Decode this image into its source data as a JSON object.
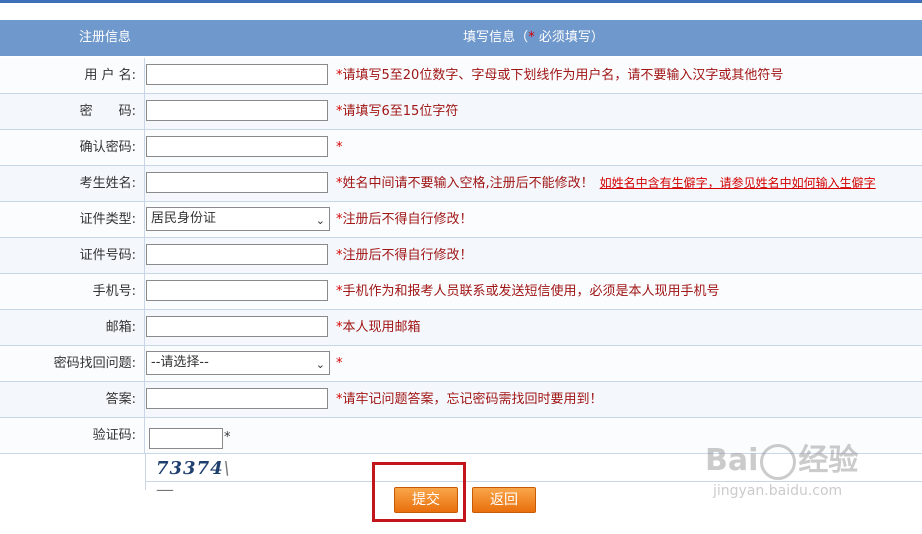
{
  "header": {
    "left": "注册信息",
    "right_prefix": "填写信息（",
    "right_star": "*",
    "right_suffix": " 必须填写）"
  },
  "form": {
    "rows": [
      {
        "label": "用 户 名:",
        "type": "text",
        "value": "",
        "hint_star": "*",
        "hint": "请填写5至20位数字、字母或下划线作为用户名，请不要输入汉字或其他符号"
      },
      {
        "label": "密　　码:",
        "type": "text",
        "value": "",
        "hint_star": "*",
        "hint": "请填写6至15位字符"
      },
      {
        "label": "确认密码:",
        "type": "text",
        "value": "",
        "hint_star": "*",
        "hint": ""
      },
      {
        "label": "考生姓名:",
        "type": "text",
        "value": "",
        "hint_star": "*",
        "hint": "姓名中间请不要输入空格,注册后不能修改！",
        "link": "如姓名中含有生僻字，请参见姓名中如何输入生僻字"
      },
      {
        "label": "证件类型:",
        "type": "select",
        "value": "居民身份证",
        "hint_star": "*",
        "hint": "注册后不得自行修改！"
      },
      {
        "label": "证件号码:",
        "type": "text",
        "value": "",
        "hint_star": "*",
        "hint": "注册后不得自行修改！"
      },
      {
        "label": "手机号:",
        "type": "text",
        "value": "",
        "hint_star": "*",
        "hint": "手机作为和报考人员联系或发送短信使用，必须是本人现用手机号"
      },
      {
        "label": "邮箱:",
        "type": "text",
        "value": "",
        "hint_star": "*",
        "hint": "本人现用邮箱"
      },
      {
        "label": "密码找回问题:",
        "type": "select",
        "value": "--请选择--",
        "hint_star": "*",
        "hint": ""
      },
      {
        "label": "答案:",
        "type": "text",
        "value": "",
        "hint_star": "*",
        "hint": "请牢记问题答案，忘记密码需找回时要用到！"
      }
    ],
    "captcha_label": "验证码:",
    "captcha_star": "*",
    "captcha_image_text": "73374",
    "captcha_image_tail": "\\—"
  },
  "buttons": {
    "submit": "提交",
    "back": "返回"
  },
  "watermark": {
    "main_left": "Bai",
    "main_right": "经验",
    "sub": "jingyan.baidu.com"
  },
  "colors": {
    "header_bg": "#6f98cc",
    "hint_text": "#a11616",
    "required_star": "#d40000",
    "button": "#f08a28",
    "highlight_box": "#c3161c"
  }
}
